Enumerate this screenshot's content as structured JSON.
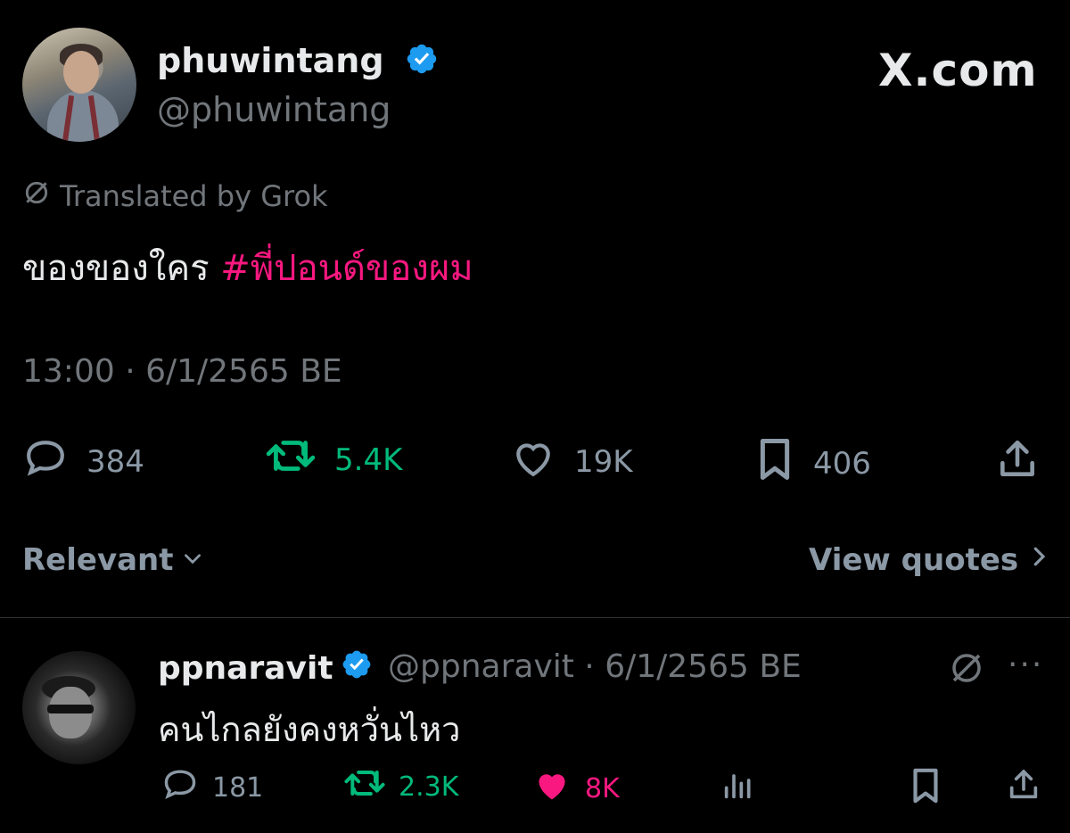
{
  "tweet": {
    "display_name": "phuwintang",
    "handle": "@phuwintang",
    "site_logo": "X.com",
    "translated_label": "Translated by Grok",
    "text_plain": "ของของใคร ",
    "hashtag": "#พี่ปอนด์ของผม",
    "timestamp": "13:00 · 6/1/2565 BE",
    "actions": {
      "replies": "384",
      "retweets": "5.4K",
      "likes": "19K",
      "bookmarks": "406"
    },
    "icons": [
      "verified-badge-icon",
      "grok-translate-icon",
      "reply-icon",
      "retweet-icon",
      "heart-icon",
      "bookmark-icon",
      "share-icon"
    ]
  },
  "sort": {
    "label": "Relevant",
    "view_quotes": "View quotes"
  },
  "reply": {
    "display_name": "ppnaravit",
    "meta": "@ppnaravit · 6/1/2565 BE",
    "more": "···",
    "text": "คนไกลยังคงหวั่นไหว",
    "actions": {
      "replies": "181",
      "retweets": "2.3K",
      "likes": "8K"
    }
  },
  "colors": {
    "background": "#000000",
    "text": "#e7e9ea",
    "muted": "#71767b",
    "hashtag": "#f91880",
    "retweet_active": "#00ba7c",
    "like_active": "#f91880",
    "verified": "#1d9bf0"
  }
}
